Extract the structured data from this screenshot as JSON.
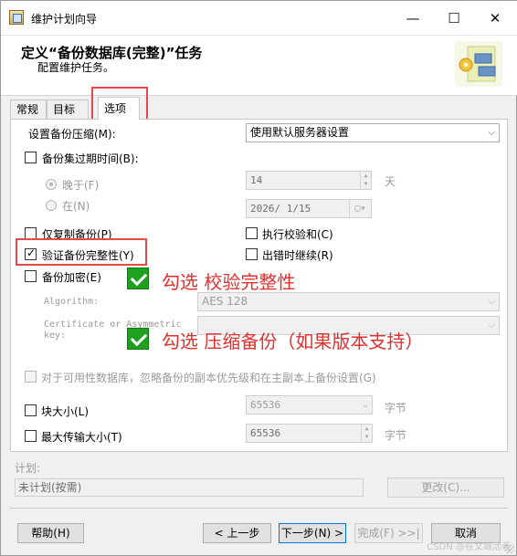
{
  "window": {
    "title": "维护计划向导",
    "controls": {
      "minimize": "—",
      "maximize": "☐",
      "close": "✕"
    }
  },
  "header": {
    "title": "定义“备份数据库(完整)”任务",
    "subtitle": "配置维护任务。"
  },
  "tabs": [
    {
      "label": "常规"
    },
    {
      "label": "目标"
    },
    {
      "label": "选项"
    }
  ],
  "options": {
    "compression_label": "设置备份压缩(M):",
    "compression_value": "使用默认服务器设置",
    "expire_label": "备份集过期时间(B):",
    "after_label": "晚于(F)",
    "after_value": "14",
    "after_unit": "天",
    "on_label": "在(N)",
    "on_value": "2026/ 1/15",
    "copy_only_label": "仅复制备份(P)",
    "checksum_label": "执行校验和(C)",
    "verify_label": "验证备份完整性(Y)",
    "verify_checked": true,
    "continue_on_error_label": "出错时继续(R)",
    "encrypt_label": "备份加密(E)",
    "algorithm_label": "Algorithm:",
    "algorithm_value": "AES 128",
    "cert_label_line1": "Certificate or Asymmetric",
    "cert_label_line2": "key:",
    "availability_label": "对于可用性数据库，忽略备份的副本优先级和在主副本上备份设置(G)",
    "block_size_label": "块大小(L)",
    "block_size_value": "65536",
    "block_size_unit": "字节",
    "max_transfer_label": "最大传输大小(T)",
    "max_transfer_value": "65536",
    "max_transfer_unit": "字节"
  },
  "annotations": {
    "verify": "勾选 校验完整性",
    "compress": "勾选 压缩备份（如果版本支持）"
  },
  "schedule": {
    "label": "计划:",
    "value": "未计划(按需)",
    "change_button": "更改(C)..."
  },
  "footer": {
    "help": "帮助(H)",
    "back": "< 上一步",
    "next": "下一步(N) >",
    "finish": "完成(F) >>|",
    "cancel": "取消"
  },
  "watermark": "CSDN @在文城活着",
  "colors": {
    "annotation_red": "#e03030",
    "check_green": "#1fa01f",
    "highlight_border": "#e8484a"
  }
}
